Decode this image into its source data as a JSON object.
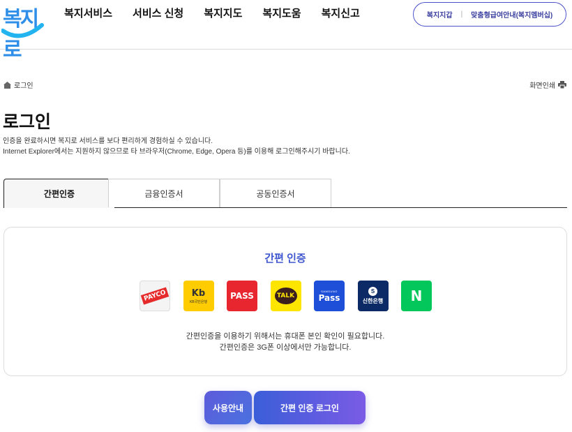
{
  "logo": {
    "text": "복지로"
  },
  "gnb": [
    {
      "label": "복지서비스"
    },
    {
      "label": "서비스 신청"
    },
    {
      "label": "복지지도"
    },
    {
      "label": "복지도움"
    },
    {
      "label": "복지신고"
    }
  ],
  "util": {
    "wallet": "복지지갑",
    "membership": "맞춤형급여안내(복지멤버십)"
  },
  "breadcrumb": {
    "home_label": "로그인"
  },
  "print_label": "화면인쇄",
  "page_title": "로그인",
  "desc": {
    "line1": "인증을 완료하시면 복지로 서비스를 보다 편리하게 경험하실 수 있습니다.",
    "line2": "Internet Explorer에서는 지원하지 않으므로 타 브라우저(Chrome, Edge, Opera 등)를 이용해 로그인해주시기 바랍니다."
  },
  "tabs": [
    {
      "label": "간편인증",
      "active": true
    },
    {
      "label": "금융인증서",
      "active": false
    },
    {
      "label": "공동인증서",
      "active": false
    }
  ],
  "panel": {
    "title": "간편 인증",
    "providers": {
      "payco": "PAYCO",
      "kb": "Kb",
      "kb_sub": "KB국민은행",
      "pass": "PASS",
      "talk": "TALK",
      "samsung_small": "SAMSUNG",
      "samsung": "Pass",
      "shinhan": "신한은행",
      "shinhan_mark": "S",
      "naver": "N"
    },
    "notice1": "간편인증을 이용하기 위해서는 휴대폰 본인 확인이 필요합니다.",
    "notice2": "간편인증은 3G폰 이상에서만 가능합니다."
  },
  "buttons": {
    "guide": "사용안내",
    "login": "간편 인증 로그인"
  }
}
